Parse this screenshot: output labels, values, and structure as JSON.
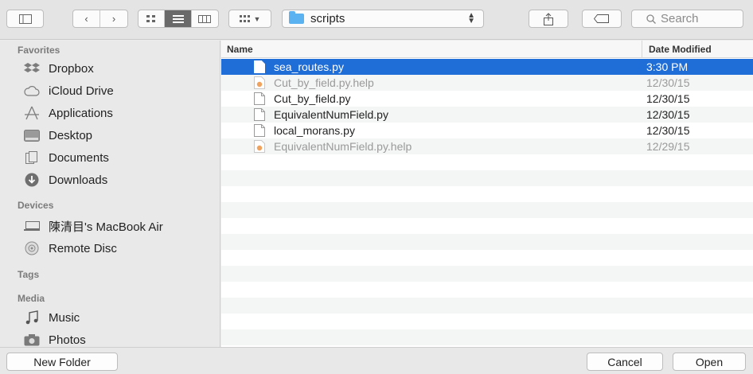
{
  "toolbar": {
    "location": "scripts",
    "search_placeholder": "Search"
  },
  "sidebar": {
    "sections": [
      {
        "title": "Favorites"
      },
      {
        "title": "Devices"
      },
      {
        "title": "Tags"
      },
      {
        "title": "Media"
      }
    ],
    "favorites": [
      {
        "label": "Dropbox",
        "icon": "dropbox-icon"
      },
      {
        "label": "iCloud Drive",
        "icon": "cloud-icon"
      },
      {
        "label": "Applications",
        "icon": "applications-icon"
      },
      {
        "label": "Desktop",
        "icon": "desktop-icon"
      },
      {
        "label": "Documents",
        "icon": "documents-icon"
      },
      {
        "label": "Downloads",
        "icon": "downloads-icon"
      }
    ],
    "devices": [
      {
        "label": "陳清目's MacBook Air",
        "icon": "laptop-icon"
      },
      {
        "label": "Remote Disc",
        "icon": "disc-icon"
      }
    ],
    "media": [
      {
        "label": "Music",
        "icon": "music-icon"
      },
      {
        "label": "Photos",
        "icon": "camera-icon"
      }
    ]
  },
  "list": {
    "columns": {
      "name": "Name",
      "date": "Date Modified"
    },
    "files": [
      {
        "name": "sea_routes.py",
        "date": "3:30 PM",
        "selected": true,
        "dim": false,
        "icon": "python-file-icon"
      },
      {
        "name": "Cut_by_field.py.help",
        "date": "12/30/15",
        "selected": false,
        "dim": true,
        "icon": "help-file-icon"
      },
      {
        "name": "Cut_by_field.py",
        "date": "12/30/15",
        "selected": false,
        "dim": false,
        "icon": "python-file-icon"
      },
      {
        "name": "EquivalentNumField.py",
        "date": "12/30/15",
        "selected": false,
        "dim": false,
        "icon": "python-file-icon"
      },
      {
        "name": "local_morans.py",
        "date": "12/30/15",
        "selected": false,
        "dim": false,
        "icon": "python-file-icon"
      },
      {
        "name": "EquivalentNumField.py.help",
        "date": "12/29/15",
        "selected": false,
        "dim": true,
        "icon": "help-file-icon"
      }
    ]
  },
  "buttons": {
    "new_folder": "New Folder",
    "cancel": "Cancel",
    "open": "Open"
  },
  "colors": {
    "selection": "#1f6dd6",
    "folder": "#5ab3f0"
  }
}
